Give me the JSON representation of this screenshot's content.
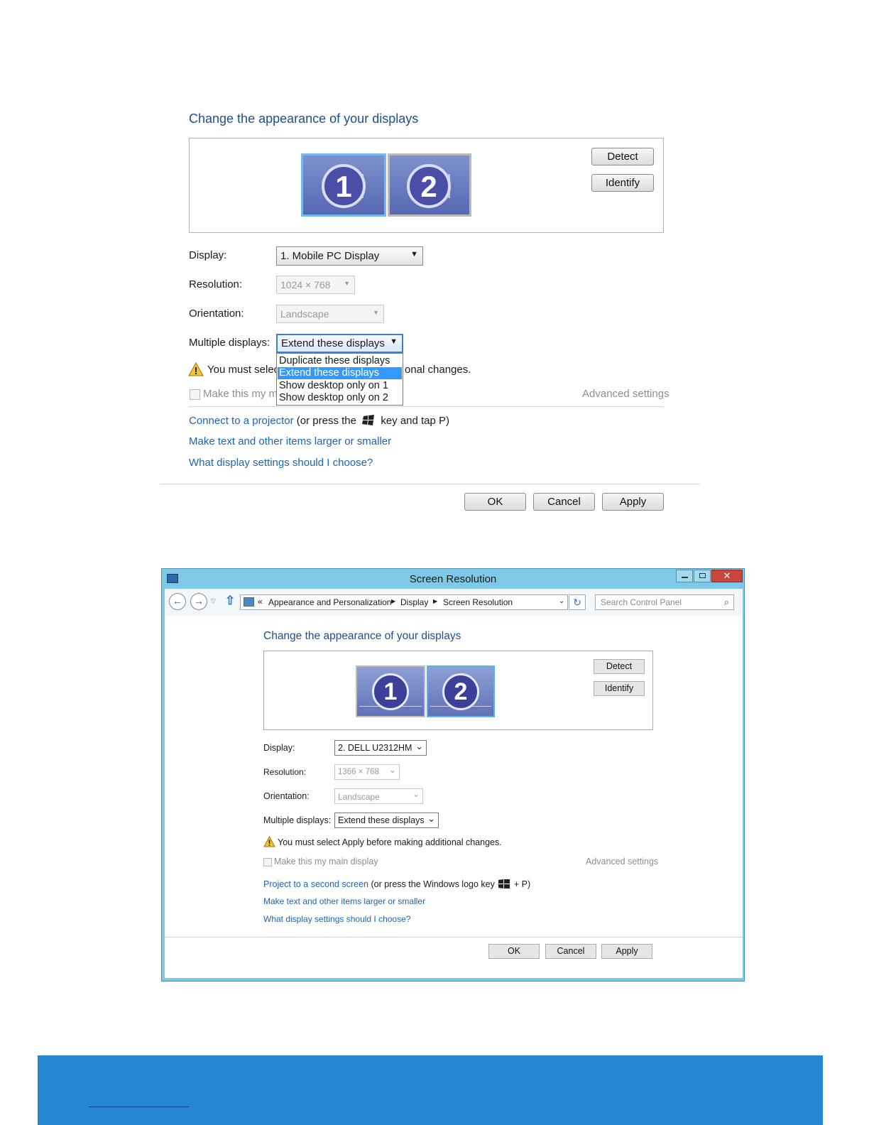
{
  "top_dialog": {
    "heading": "Change the appearance of your displays",
    "monitors": [
      "1",
      "2"
    ],
    "detect_label": "Detect",
    "identify_label": "Identify",
    "display_label": "Display:",
    "display_value": "1. Mobile PC Display",
    "resolution_label": "Resolution:",
    "resolution_value": "1024 × 768",
    "orientation_label": "Orientation:",
    "orientation_value": "Landscape",
    "multiple_label": "Multiple displays:",
    "multiple_value": "Extend these displays",
    "dropdown_options": [
      "Duplicate these displays",
      "Extend these displays",
      "Show desktop only on 1",
      "Show desktop only on 2"
    ],
    "dropdown_selected": "Extend these displays",
    "warning_text_left": "You must selec",
    "warning_text_right": "onal changes.",
    "main_display_label": "Make this my ma",
    "advanced_label": "Advanced settings",
    "projector_link": "Connect to a projector",
    "projector_rest_a": "(or press the",
    "projector_rest_b": "key and tap P)",
    "text_size_link": "Make text and other items larger or smaller",
    "help_link": "What display settings should I choose?",
    "ok_label": "OK",
    "cancel_label": "Cancel",
    "apply_label": "Apply"
  },
  "window": {
    "title": "Screen Resolution",
    "breadcrumb_prefix": "«",
    "breadcrumb": [
      "Appearance and Personalization",
      "Display",
      "Screen Resolution"
    ],
    "search_placeholder": "Search Control Panel",
    "heading": "Change the appearance of your displays",
    "monitors": [
      "1",
      "2"
    ],
    "detect_label": "Detect",
    "identify_label": "Identify",
    "display_label": "Display:",
    "display_value": "2. DELL U2312HM",
    "resolution_label": "Resolution:",
    "resolution_value": "1366 × 768",
    "orientation_label": "Orientation:",
    "orientation_value": "Landscape",
    "multiple_label": "Multiple displays:",
    "multiple_value": "Extend these displays",
    "warning_text": "You must select Apply before making additional changes.",
    "main_display_label": "Make this my main display",
    "advanced_label": "Advanced settings",
    "project_link": "Project to a second screen",
    "project_rest_a": "(or press the Windows logo key",
    "project_rest_b": "+ P)",
    "text_size_link": "Make text and other items larger or smaller",
    "help_link": "What display settings should I choose?",
    "ok_label": "OK",
    "cancel_label": "Cancel",
    "apply_label": "Apply"
  },
  "colors": {
    "link": "#1e63b5",
    "heading": "#1f4e8c",
    "title_bar": "#7ec8e8",
    "close_button": "#c9473a",
    "footer_band": "#2387d4",
    "selected_item": "#3399ff"
  }
}
